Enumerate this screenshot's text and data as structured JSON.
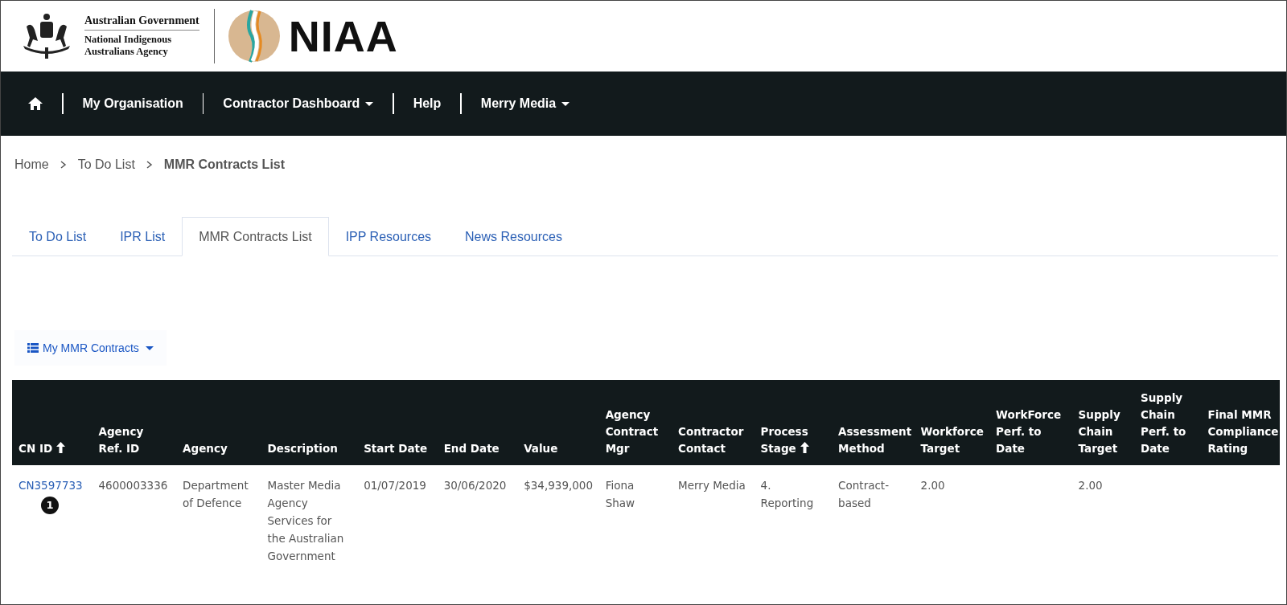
{
  "header": {
    "gov_name": "Australian Government",
    "agency_line_1": "National Indigenous",
    "agency_line_2": "Australians Agency",
    "logo_text": "NIAA"
  },
  "nav": [
    {
      "label": "My Organisation",
      "dropdown": false
    },
    {
      "label": "Contractor Dashboard",
      "dropdown": true
    },
    {
      "label": "Help",
      "dropdown": false
    },
    {
      "label": "Merry Media",
      "dropdown": true
    }
  ],
  "breadcrumb": [
    "Home",
    "To Do List",
    "MMR Contracts List"
  ],
  "tabs": [
    {
      "label": "To Do List",
      "selected": false
    },
    {
      "label": "IPR List",
      "selected": false
    },
    {
      "label": "MMR Contracts List",
      "selected": true
    },
    {
      "label": "IPP Resources",
      "selected": false
    },
    {
      "label": "News Resources",
      "selected": false
    }
  ],
  "view_menu": {
    "label": "My MMR Contracts"
  },
  "table": {
    "columns": [
      {
        "label": "CN ID",
        "sorted": true
      },
      {
        "label": "Agency Ref. ID",
        "sorted": false
      },
      {
        "label": "Agency",
        "sorted": false
      },
      {
        "label": "Description",
        "sorted": false
      },
      {
        "label": "Start Date",
        "sorted": false
      },
      {
        "label": "End Date",
        "sorted": false
      },
      {
        "label": "Value",
        "sorted": false
      },
      {
        "label": "Agency Contract Mgr",
        "sorted": false
      },
      {
        "label": "Contractor Contact",
        "sorted": false
      },
      {
        "label": "Process Stage",
        "sorted": true
      },
      {
        "label": "Assessment Method",
        "sorted": false
      },
      {
        "label": "Workforce Target",
        "sorted": false
      },
      {
        "label": "WorkForce Perf. to Date",
        "sorted": false
      },
      {
        "label": "Supply Chain Target",
        "sorted": false
      },
      {
        "label": "Supply Chain Perf. to Date",
        "sorted": false
      },
      {
        "label": "Final MMR Compliance Rating",
        "sorted": false
      }
    ],
    "rows": [
      {
        "cells": [
          "CN3597733",
          "4600003336",
          "Department of Defence",
          "Master Media Agency Services for the Australian Government",
          "01/07/2019",
          "30/06/2020",
          "$34,939,000",
          "Fiona Shaw",
          "Merry Media",
          "4. Reporting",
          "Contract-based",
          "2.00",
          "",
          "2.00",
          "",
          ""
        ],
        "callout": "1"
      }
    ]
  }
}
